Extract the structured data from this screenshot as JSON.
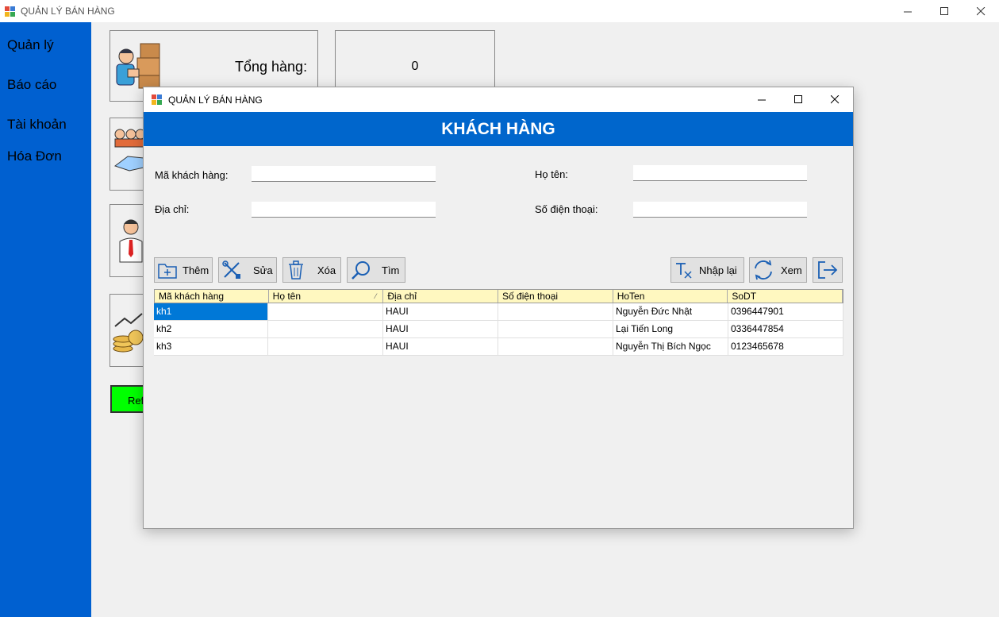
{
  "main_window": {
    "title": "QUẢN LÝ BÁN HÀNG"
  },
  "sidebar": {
    "items": [
      {
        "label": "Quản lý"
      },
      {
        "label": "Báo cáo"
      },
      {
        "label": "Tài khoản"
      },
      {
        "label": "Hóa Đơn"
      }
    ]
  },
  "dashboard": {
    "total_label": "Tổng hàng:",
    "total_value": "0",
    "refresh_label": "Ref"
  },
  "dialog": {
    "title": "QUẢN LÝ BÁN HÀNG",
    "banner": "KHÁCH HÀNG",
    "fields": {
      "ma_label": "Mã khách hàng:",
      "ma_value": "",
      "hoten_label": "Họ tên:",
      "hoten_value": "",
      "diachi_label": "Địa chỉ:",
      "diachi_value": "",
      "sdt_label": "Số điện thoại:",
      "sdt_value": ""
    },
    "toolbar": {
      "add": "Thêm",
      "edit": "Sửa",
      "delete": "Xóa",
      "search": "Tìm",
      "reset": "Nhập lại",
      "view": "Xem"
    },
    "grid": {
      "columns": [
        "Mã khách hàng",
        "Họ tên",
        "Địa chỉ",
        "Số điện thoại",
        "HoTen",
        "SoDT"
      ],
      "rows": [
        {
          "ma": "kh1",
          "hoten": "",
          "diachi": "HAUI",
          "sdt": "",
          "hoten2": "Nguyễn Đức Nhật",
          "sodt": "0396447901"
        },
        {
          "ma": "kh2",
          "hoten": "",
          "diachi": "HAUI",
          "sdt": "",
          "hoten2": "Lại Tiến Long",
          "sodt": "0336447854"
        },
        {
          "ma": "kh3",
          "hoten": "",
          "diachi": "HAUI",
          "sdt": "",
          "hoten2": "Nguyễn Thị Bích Ngọc",
          "sodt": "0123465678"
        }
      ]
    }
  },
  "colors": {
    "sidebar": "#0060d0",
    "banner": "#0066cc",
    "grid_header": "#fff8c0",
    "selection": "#0078d7",
    "refresh": "#00ff00"
  }
}
